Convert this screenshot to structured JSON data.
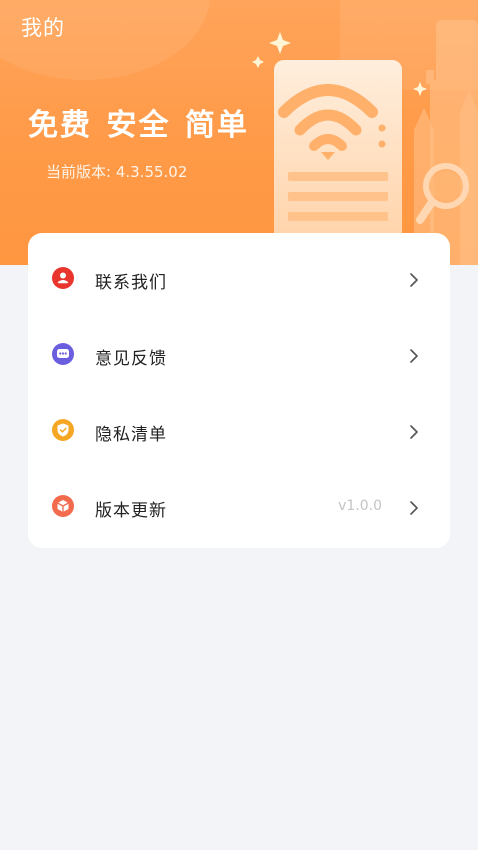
{
  "header": {
    "title": "我的",
    "slogan": "免费 安全 简单",
    "version_text": "当前版本: 4.3.55.02"
  },
  "menu": {
    "items": [
      {
        "label": "联系我们",
        "icon": "contact-icon",
        "color": "#e8352e",
        "value": ""
      },
      {
        "label": "意见反馈",
        "icon": "feedback-icon",
        "color": "#6b5fe0",
        "value": ""
      },
      {
        "label": "隐私清单",
        "icon": "privacy-shield-icon",
        "color": "#f5a623",
        "value": ""
      },
      {
        "label": "版本更新",
        "icon": "update-icon",
        "color": "#f26b4d",
        "value": "v1.0.0"
      }
    ]
  },
  "colors": {
    "header_bg": "#ff9a48",
    "page_bg": "#f2f4f8",
    "card_bg": "#ffffff"
  }
}
